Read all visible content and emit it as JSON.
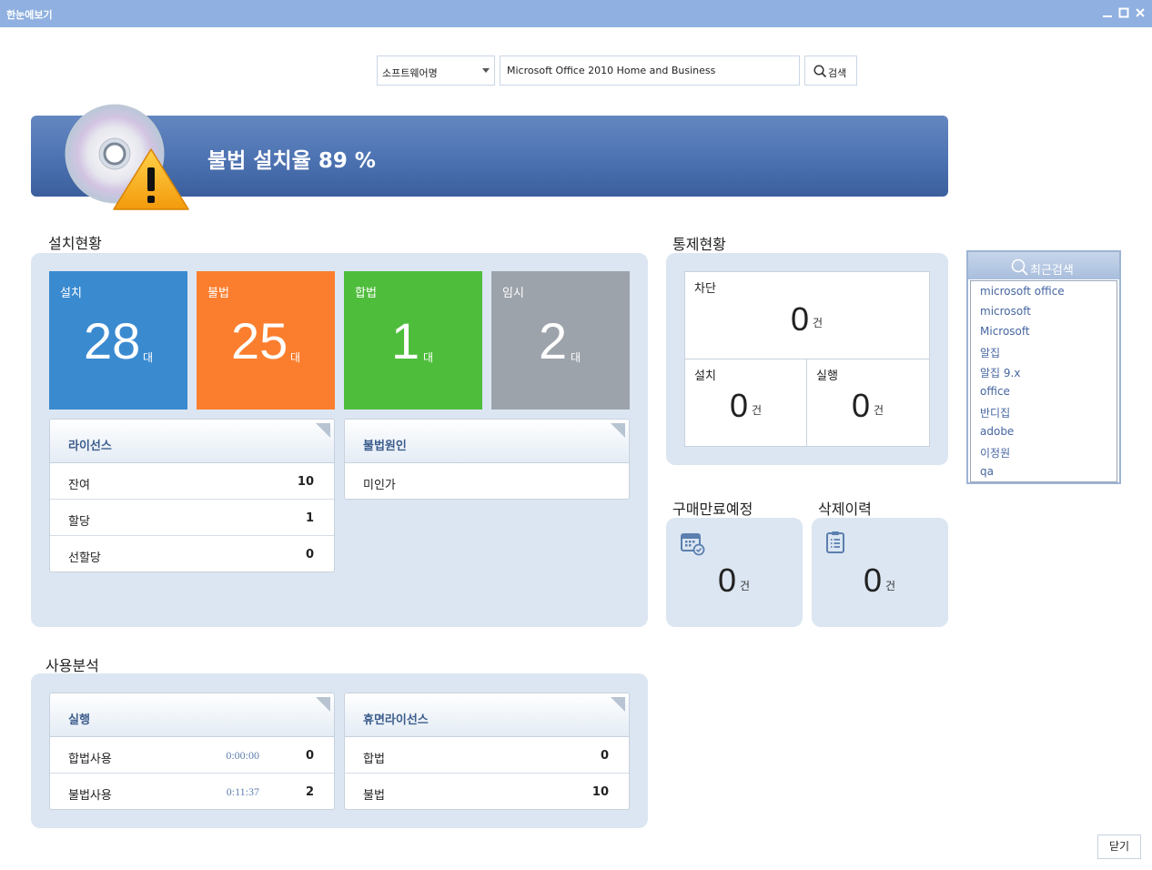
{
  "window": {
    "title": "한눈에보기"
  },
  "search": {
    "category": "소프트웨어명",
    "query": "Microsoft Office 2010 Home and Business",
    "button_label": "검색"
  },
  "banner": {
    "text": "불법 설치율 89 %"
  },
  "install_status": {
    "title": "설치현황",
    "tiles": [
      {
        "label": "설치",
        "value": "28",
        "unit": "대",
        "color": "#3a8ad0"
      },
      {
        "label": "불법",
        "value": "25",
        "unit": "대",
        "color": "#fb7e2e"
      },
      {
        "label": "합법",
        "value": "1",
        "unit": "대",
        "color": "#4fbd3c"
      },
      {
        "label": "임시",
        "value": "2",
        "unit": "대",
        "color": "#9da3ab"
      }
    ],
    "license": {
      "title": "라이선스",
      "rows": [
        {
          "label": "잔여",
          "value": "10"
        },
        {
          "label": "할당",
          "value": "1"
        },
        {
          "label": "선할당",
          "value": "0"
        }
      ]
    },
    "illegal_cause": {
      "title": "불법원인",
      "rows": [
        {
          "label": "미인가"
        }
      ]
    }
  },
  "control_status": {
    "title": "통제현황",
    "block": {
      "label": "차단",
      "value": "0",
      "unit": "건"
    },
    "install": {
      "label": "설치",
      "value": "0",
      "unit": "건"
    },
    "execute": {
      "label": "실행",
      "value": "0",
      "unit": "건"
    }
  },
  "purchase_expiry": {
    "title": "구매만료예정",
    "value": "0",
    "unit": "건"
  },
  "delete_history": {
    "title": "삭제이력",
    "value": "0",
    "unit": "건"
  },
  "recent_search": {
    "title": "최근검색",
    "items": [
      "microsoft office",
      "microsoft",
      "Microsoft",
      "알집",
      "알집 9.x",
      "office",
      "반디집",
      "adobe",
      "이정원",
      "qa"
    ]
  },
  "usage_analysis": {
    "title": "사용분석",
    "execution": {
      "title": "실행",
      "rows": [
        {
          "label": "합법사용",
          "time": "0:00:00",
          "value": "0"
        },
        {
          "label": "불법사용",
          "time": "0:11:37",
          "value": "2"
        }
      ]
    },
    "idle_license": {
      "title": "휴면라이선스",
      "rows": [
        {
          "label": "합법",
          "value": "0"
        },
        {
          "label": "불법",
          "value": "10"
        }
      ]
    }
  },
  "close_button": "닫기",
  "colors": {
    "titlebar": "#8fb0e0",
    "banner": "#4e74b3",
    "panel": "#dce6f2"
  },
  "icons": [
    "disc-warning-icon",
    "search-icon",
    "calendar-icon",
    "clipboard-icon",
    "minimize-icon",
    "maximize-icon",
    "close-icon"
  ]
}
